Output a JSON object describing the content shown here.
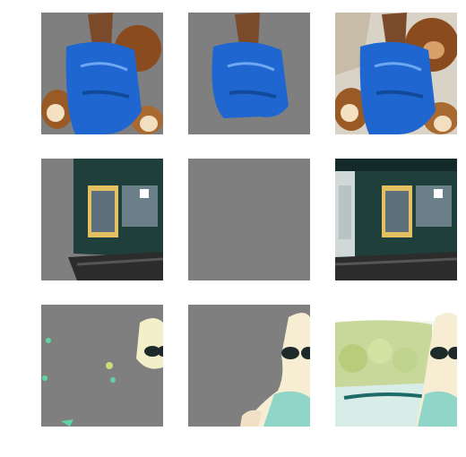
{
  "colors": {
    "background": "#ffffff",
    "mask_gray": "#7f7f7f"
  },
  "grid": {
    "rows": [
      {
        "subject": "robe-with-teddy-bear",
        "cells": [
          {
            "kind": "masked-partial"
          },
          {
            "kind": "masked-partial"
          },
          {
            "kind": "full-image"
          }
        ]
      },
      {
        "subject": "storefront",
        "cells": [
          {
            "kind": "masked-partial"
          },
          {
            "kind": "fully-masked"
          },
          {
            "kind": "full-image"
          }
        ]
      },
      {
        "subject": "woman-in-car",
        "cells": [
          {
            "kind": "masked-partial"
          },
          {
            "kind": "masked-partial"
          },
          {
            "kind": "full-image"
          }
        ]
      }
    ]
  }
}
